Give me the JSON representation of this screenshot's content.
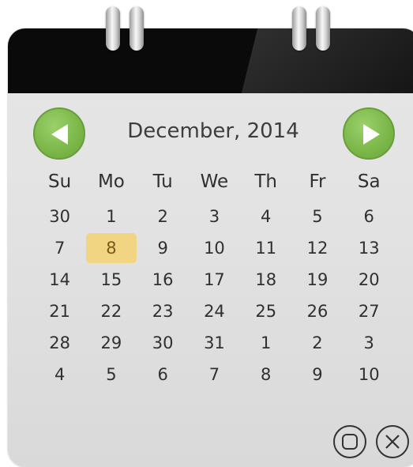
{
  "calendar": {
    "month_title": "December, 2014",
    "weekdays": [
      "Su",
      "Mo",
      "Tu",
      "We",
      "Th",
      "Fr",
      "Sa"
    ],
    "weeks": [
      [
        "30",
        "1",
        "2",
        "3",
        "4",
        "5",
        "6"
      ],
      [
        "7",
        "8",
        "9",
        "10",
        "11",
        "12",
        "13"
      ],
      [
        "14",
        "15",
        "16",
        "17",
        "18",
        "19",
        "20"
      ],
      [
        "21",
        "22",
        "23",
        "24",
        "25",
        "26",
        "27"
      ],
      [
        "28",
        "29",
        "30",
        "31",
        "1",
        "2",
        "3"
      ],
      [
        "4",
        "5",
        "6",
        "7",
        "8",
        "9",
        "10"
      ]
    ],
    "today": "8"
  },
  "nav": {
    "prev_icon": "triangle-left-icon",
    "next_icon": "triangle-right-icon"
  },
  "window_controls": {
    "restore_icon": "restore-icon",
    "close_icon": "close-icon"
  },
  "colors": {
    "header": "#0a0a0a",
    "nav_button": "#7ab648",
    "today_highlight": "#f2d583",
    "body": "#e3e3e3"
  }
}
